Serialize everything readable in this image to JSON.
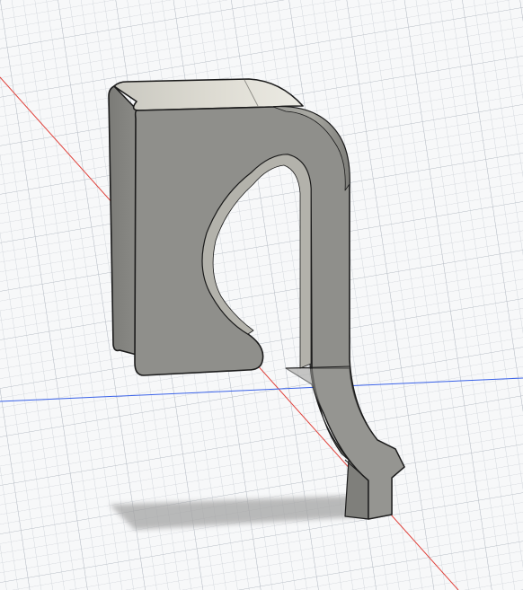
{
  "viewport": {
    "grid_visible": true,
    "axes": [
      {
        "name": "x-axis",
        "color": "#e0413a"
      },
      {
        "name": "y-axis",
        "color": "#3a62e8"
      }
    ]
  },
  "model": {
    "shape": "hook-clip",
    "body_color": "#8b8b87",
    "face_color": "#8f8f8b",
    "top_color": "#dcdbd3",
    "edge_color": "#1b1b1b",
    "shadow_color": "#a4a4a4"
  }
}
